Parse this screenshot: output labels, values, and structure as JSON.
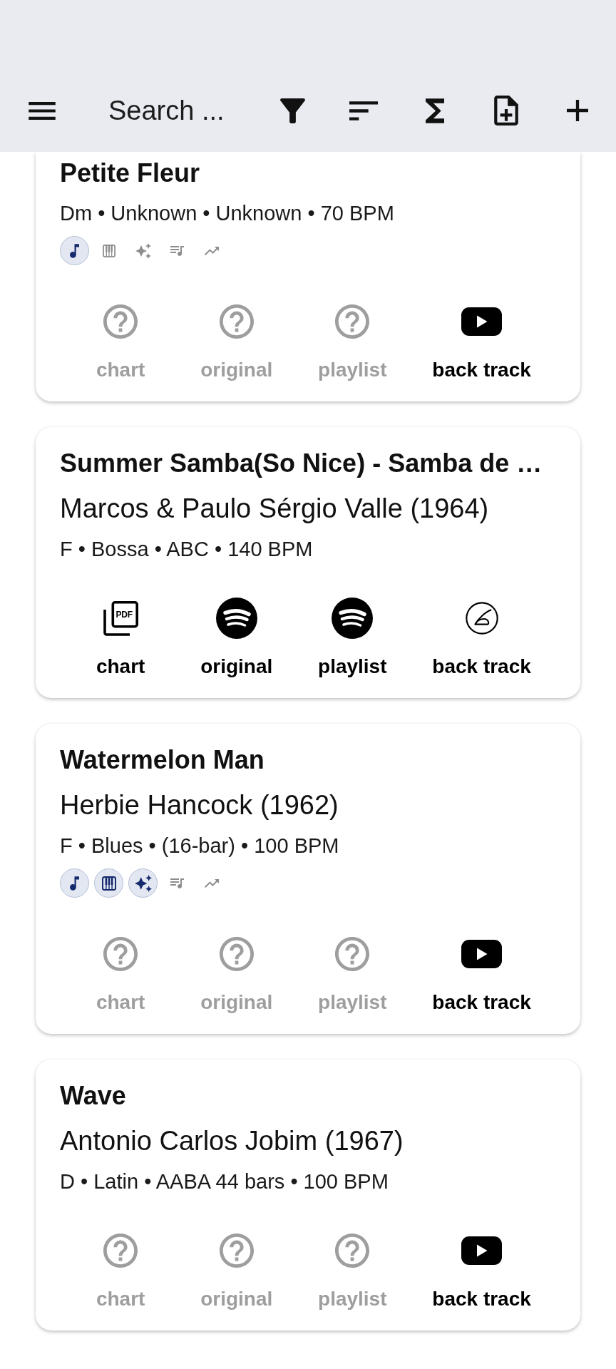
{
  "app_bar": {
    "search": {
      "placeholder": "Search ..."
    }
  },
  "cards": [
    {
      "title": "Petite Fleur",
      "details": "Dm • Unknown • Unknown • 70 BPM",
      "tags": [
        {
          "on": true
        },
        {
          "on": false
        },
        {
          "on": false
        },
        {
          "on": false
        },
        {
          "on": false
        }
      ],
      "links": [
        {
          "label": "chart",
          "kind": "none",
          "disabled": true
        },
        {
          "label": "original",
          "kind": "none",
          "disabled": true
        },
        {
          "label": "playlist",
          "kind": "none",
          "disabled": true
        },
        {
          "label": "back track",
          "kind": "video",
          "disabled": false
        }
      ]
    },
    {
      "title": "Summer Samba(So Nice) - Samba de …",
      "composer": "Marcos & Paulo Sérgio Valle (1964)",
      "details": "F • Bossa • ABC • 140 BPM",
      "links": [
        {
          "label": "chart",
          "kind": "pdf",
          "icon_text": "PDF",
          "disabled": false
        },
        {
          "label": "original",
          "kind": "streaming",
          "disabled": false
        },
        {
          "label": "playlist",
          "kind": "streaming",
          "disabled": false
        },
        {
          "label": "back track",
          "kind": "custom",
          "disabled": false
        }
      ]
    },
    {
      "title": "Watermelon Man",
      "composer": "Herbie Hancock (1962)",
      "details": "F • Blues • (16-bar) • 100 BPM",
      "tags": [
        {
          "on": true
        },
        {
          "on": true
        },
        {
          "on": true
        },
        {
          "on": false
        },
        {
          "on": false
        }
      ],
      "links": [
        {
          "label": "chart",
          "kind": "none",
          "disabled": true
        },
        {
          "label": "original",
          "kind": "none",
          "disabled": true
        },
        {
          "label": "playlist",
          "kind": "none",
          "disabled": true
        },
        {
          "label": "back track",
          "kind": "video",
          "disabled": false
        }
      ]
    },
    {
      "title": "Wave",
      "composer": "Antonio Carlos Jobim (1967)",
      "details": "D • Latin • AABA 44 bars • 100 BPM",
      "links": [
        {
          "label": "chart",
          "kind": "none",
          "disabled": true
        },
        {
          "label": "original",
          "kind": "none",
          "disabled": true
        },
        {
          "label": "playlist",
          "kind": "none",
          "disabled": true
        },
        {
          "label": "back track",
          "kind": "video",
          "disabled": false
        }
      ]
    }
  ]
}
